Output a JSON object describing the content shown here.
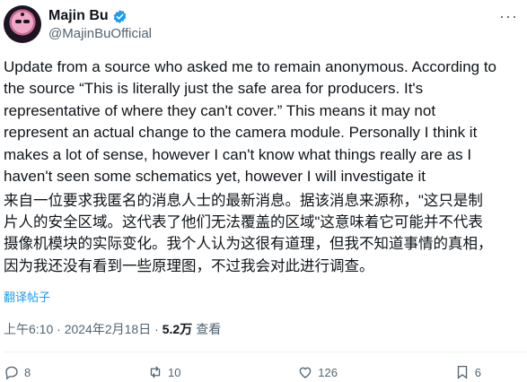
{
  "author": {
    "name": "Majin Bu",
    "handle": "@MajinBuOfficial",
    "verified_color": "#1d9bf0"
  },
  "more_icon": "···",
  "post": {
    "text_en": "Update from a source who asked me to remain anonymous. According to\nthe source “This is literally just the safe area for producers. It's\nrepresentative of where they can't cover.” This means it may not\nrepresent an actual change to the camera module. Personally I think it\nmakes a lot of sense, however I can't know what things really are as I\nhaven't seen some schematics yet, however I will investigate it",
    "text_zh": "来自一位要求我匿名的消息人士的最新消息。据该消息来源称，\"这只是制\n片人的安全区域。这代表了他们无法覆盖的区域\"这意味着它可能并不代表\n摄像机模块的实际变化。我个人认为这很有道理，但我不知道事情的真相，\n因为我还没有看到一些原理图，不过我会对此进行调查。",
    "translate_label": "翻译帖子"
  },
  "meta": {
    "timestamp": "上午6:10 · 2024年2月18日 · ",
    "views": "5.2万",
    "views_label": "查看"
  },
  "actions": [
    {
      "name": "reply",
      "icon": "reply-icon",
      "count": "8"
    },
    {
      "name": "repost",
      "icon": "repost-icon",
      "count": "10"
    },
    {
      "name": "like",
      "icon": "heart-icon",
      "count": "126"
    },
    {
      "name": "bookmark",
      "icon": "bookmark-icon",
      "count": "6"
    }
  ]
}
